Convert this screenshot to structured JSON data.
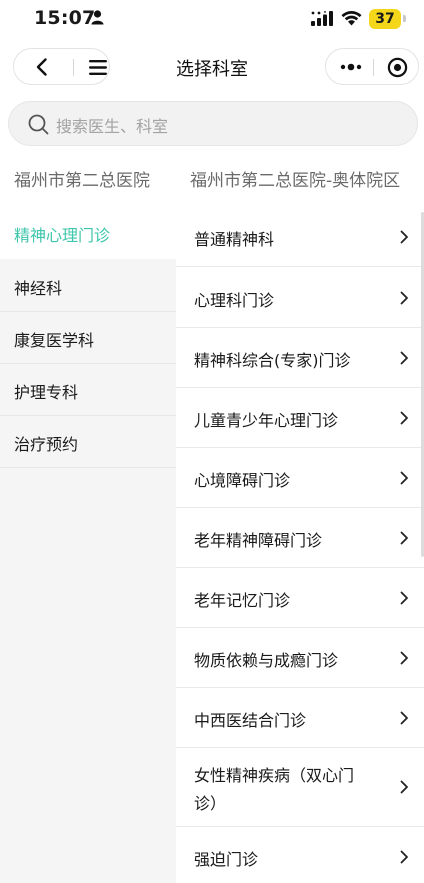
{
  "status_bar": {
    "time": "15:07",
    "battery": "37",
    "icons": [
      "person-icon",
      "signal-icon",
      "wifi-icon",
      "battery-icon"
    ]
  },
  "nav_bar": {
    "title": "选择科室",
    "icons": [
      "back-icon",
      "menu-icon",
      "more-icon",
      "close-miniprogram-icon"
    ]
  },
  "search": {
    "placeholder": "搜索医生、科室"
  },
  "hospitals": [
    {
      "label": "福州市第二总医院"
    },
    {
      "label": "福州市第二总医院-奥体院区"
    }
  ],
  "categories": [
    {
      "label": "精神心理门诊",
      "active": true
    },
    {
      "label": "神经科"
    },
    {
      "label": "康复医学科"
    },
    {
      "label": "护理专科"
    },
    {
      "label": "治疗预约"
    }
  ],
  "departments": [
    {
      "label": "普通精神科"
    },
    {
      "label": "心理科门诊"
    },
    {
      "label": "精神科综合(专家)门诊"
    },
    {
      "label": "儿童青少年心理门诊"
    },
    {
      "label": "心境障碍门诊"
    },
    {
      "label": "老年精神障碍门诊"
    },
    {
      "label": "老年记忆门诊"
    },
    {
      "label": "物质依赖与成瘾门诊"
    },
    {
      "label": "中西医结合门诊"
    },
    {
      "label": "女性精神疾病（双心门诊）"
    },
    {
      "label": "强迫门诊"
    }
  ],
  "colors": {
    "accent": "#3ec6ac",
    "battery": "#f4d71b",
    "sidebar_bg": "#f5f5f5"
  }
}
